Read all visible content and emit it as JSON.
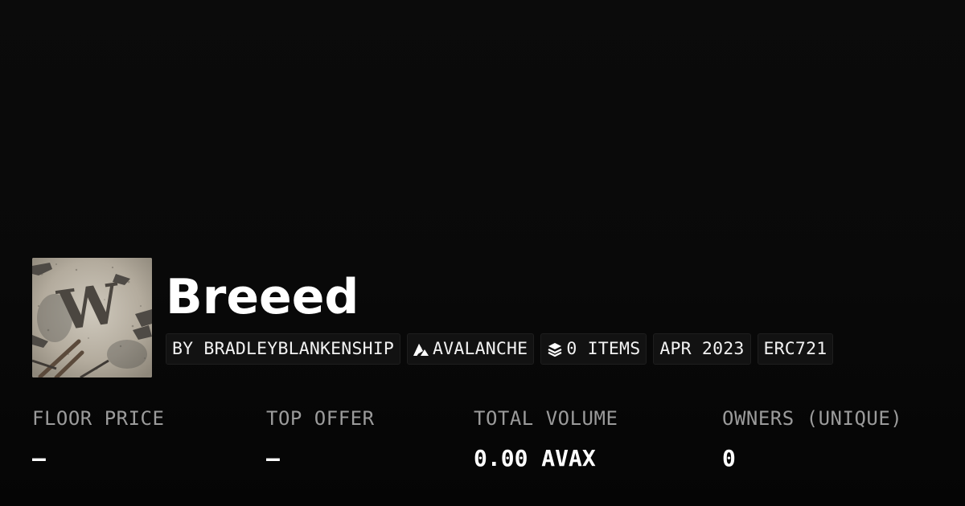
{
  "collection": {
    "name": "Breeed",
    "avatar_mark": "W"
  },
  "tags": {
    "creator": "BY BRADLEYBLANKENSHIP",
    "chain": "AVALANCHE",
    "chain_icon": "avalanche-icon",
    "items": "0 ITEMS",
    "items_icon": "layers-icon",
    "date": "APR 2023",
    "standard": "ERC721"
  },
  "stats": {
    "floor_price": {
      "label": "FLOOR PRICE",
      "value": "–"
    },
    "top_offer": {
      "label": "TOP OFFER",
      "value": "–"
    },
    "total_volume": {
      "label": "TOTAL VOLUME",
      "value": "0.00 AVAX"
    },
    "owners": {
      "label": "OWNERS (UNIQUE)",
      "value": "0"
    }
  },
  "colors": {
    "background": "#0a0a0a",
    "text": "#ffffff",
    "muted": "#9b9b9b",
    "tag_bg": "#121212"
  }
}
